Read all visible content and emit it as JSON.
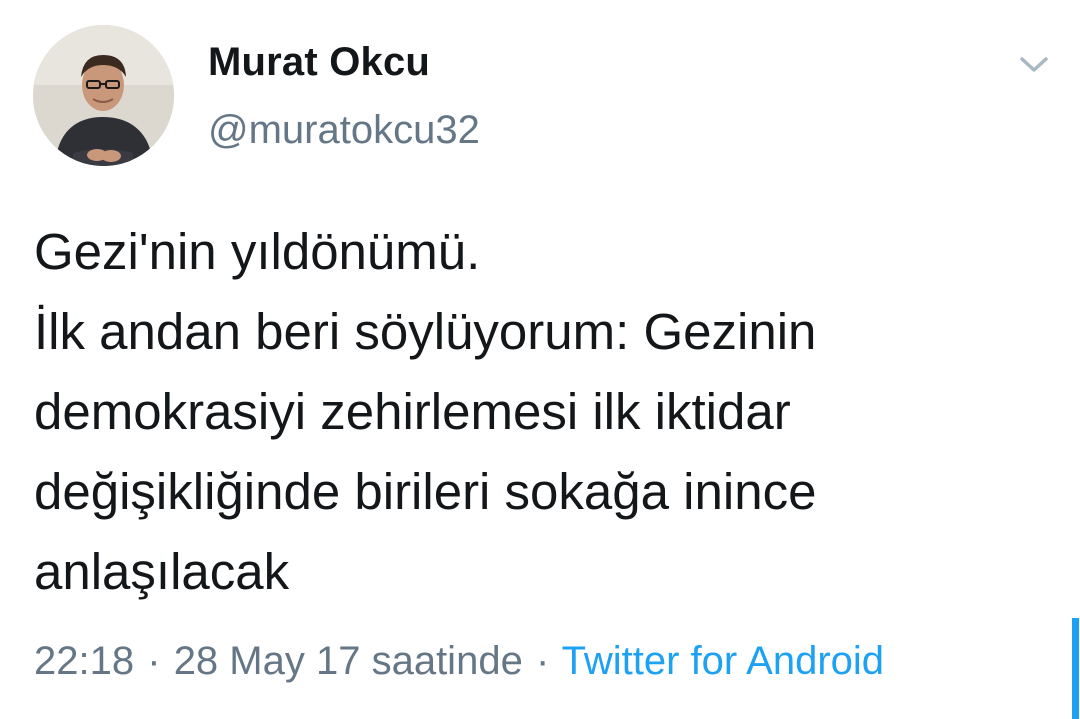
{
  "user": {
    "display_name": "Murat Okcu",
    "handle": "@muratokcu32"
  },
  "tweet": {
    "text": "Gezi'nin yıldönümü.\nİlk andan beri söylüyorum: Gezinin demokrasiyi zehirlemesi ilk iktidar değişikliğinde birileri sokağa inince anlaşılacak",
    "time": "22:18",
    "separator": "·",
    "date": "28 May 17 saatinde",
    "source": "Twitter for Android"
  },
  "icons": {
    "menu": "chevron-down-icon"
  },
  "colors": {
    "text": "#14171a",
    "muted": "#657786",
    "link": "#1da1f2"
  }
}
